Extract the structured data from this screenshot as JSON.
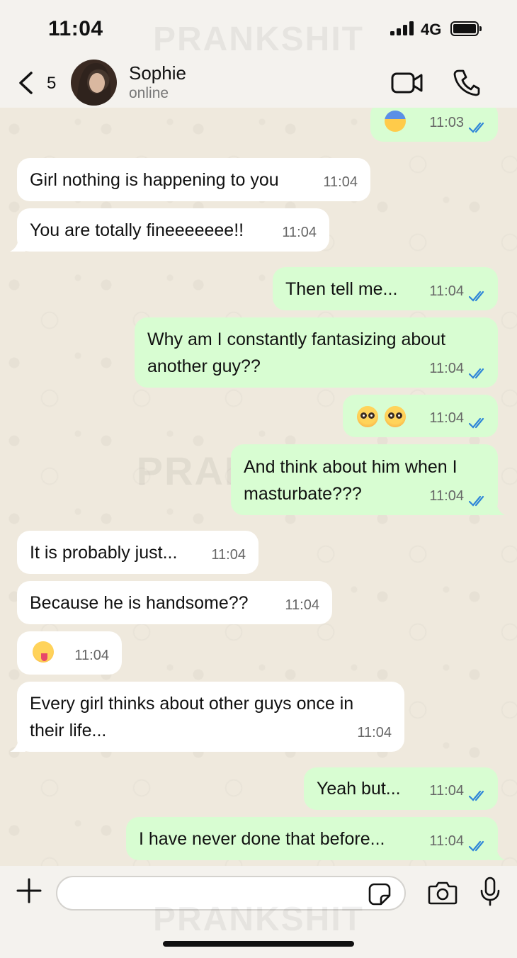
{
  "status_bar": {
    "time": "11:04",
    "network": "4G",
    "battery_icon": "battery-icon",
    "signal_icon": "signal-bars-icon"
  },
  "watermark": "PRANKSHIT",
  "header": {
    "back_count": "5",
    "contact_name": "Sophie",
    "contact_status": "online",
    "icons": [
      "back-chevron-icon",
      "video-camera-icon",
      "phone-icon"
    ]
  },
  "messages": [
    {
      "dir": "out",
      "text": "",
      "emoji": "face-screaming-in-fear",
      "time": "11:03",
      "read": true
    },
    {
      "dir": "in",
      "text": "Girl nothing is happening to you",
      "time": "11:04"
    },
    {
      "dir": "in",
      "text": "You are totally fineeeeeee!!",
      "time": "11:04"
    },
    {
      "dir": "out",
      "text": "Then tell me...",
      "time": "11:04",
      "read": true
    },
    {
      "dir": "out",
      "text": "Why am I constantly fantasizing about another guy??",
      "line1": "Why am I constantly fantasizing about",
      "line2": "another guy??",
      "time": "11:04",
      "read": true
    },
    {
      "dir": "out",
      "text": "",
      "emoji": "flushed-face x2",
      "time": "11:04",
      "read": true
    },
    {
      "dir": "out",
      "text": "And think about him when I masturbate???",
      "line1": "And think about him when I",
      "line2": "masturbate???",
      "time": "11:04",
      "read": true
    },
    {
      "dir": "in",
      "text": "It is probably just...",
      "time": "11:04"
    },
    {
      "dir": "in",
      "text": "Because he is handsome??",
      "time": "11:04"
    },
    {
      "dir": "in",
      "text": "",
      "emoji": "zany-face",
      "time": "11:04"
    },
    {
      "dir": "in",
      "text": "Every girl thinks about other guys once in their life...",
      "line1": "Every girl thinks about other guys once in",
      "line2": "their life...",
      "time": "11:04"
    },
    {
      "dir": "out",
      "text": "Yeah but...",
      "time": "11:04",
      "read": true
    },
    {
      "dir": "out",
      "text": "I have never done that before...",
      "time": "11:04",
      "read": true
    }
  ],
  "input_bar": {
    "placeholder": "",
    "icons": [
      "plus-icon",
      "sticker-icon",
      "camera-icon",
      "microphone-icon"
    ]
  },
  "colors": {
    "incoming_bubble": "#ffffff",
    "outgoing_bubble": "#d8fdd2",
    "read_ticks": "#2f86d8",
    "chat_background": "#efe9dd"
  }
}
